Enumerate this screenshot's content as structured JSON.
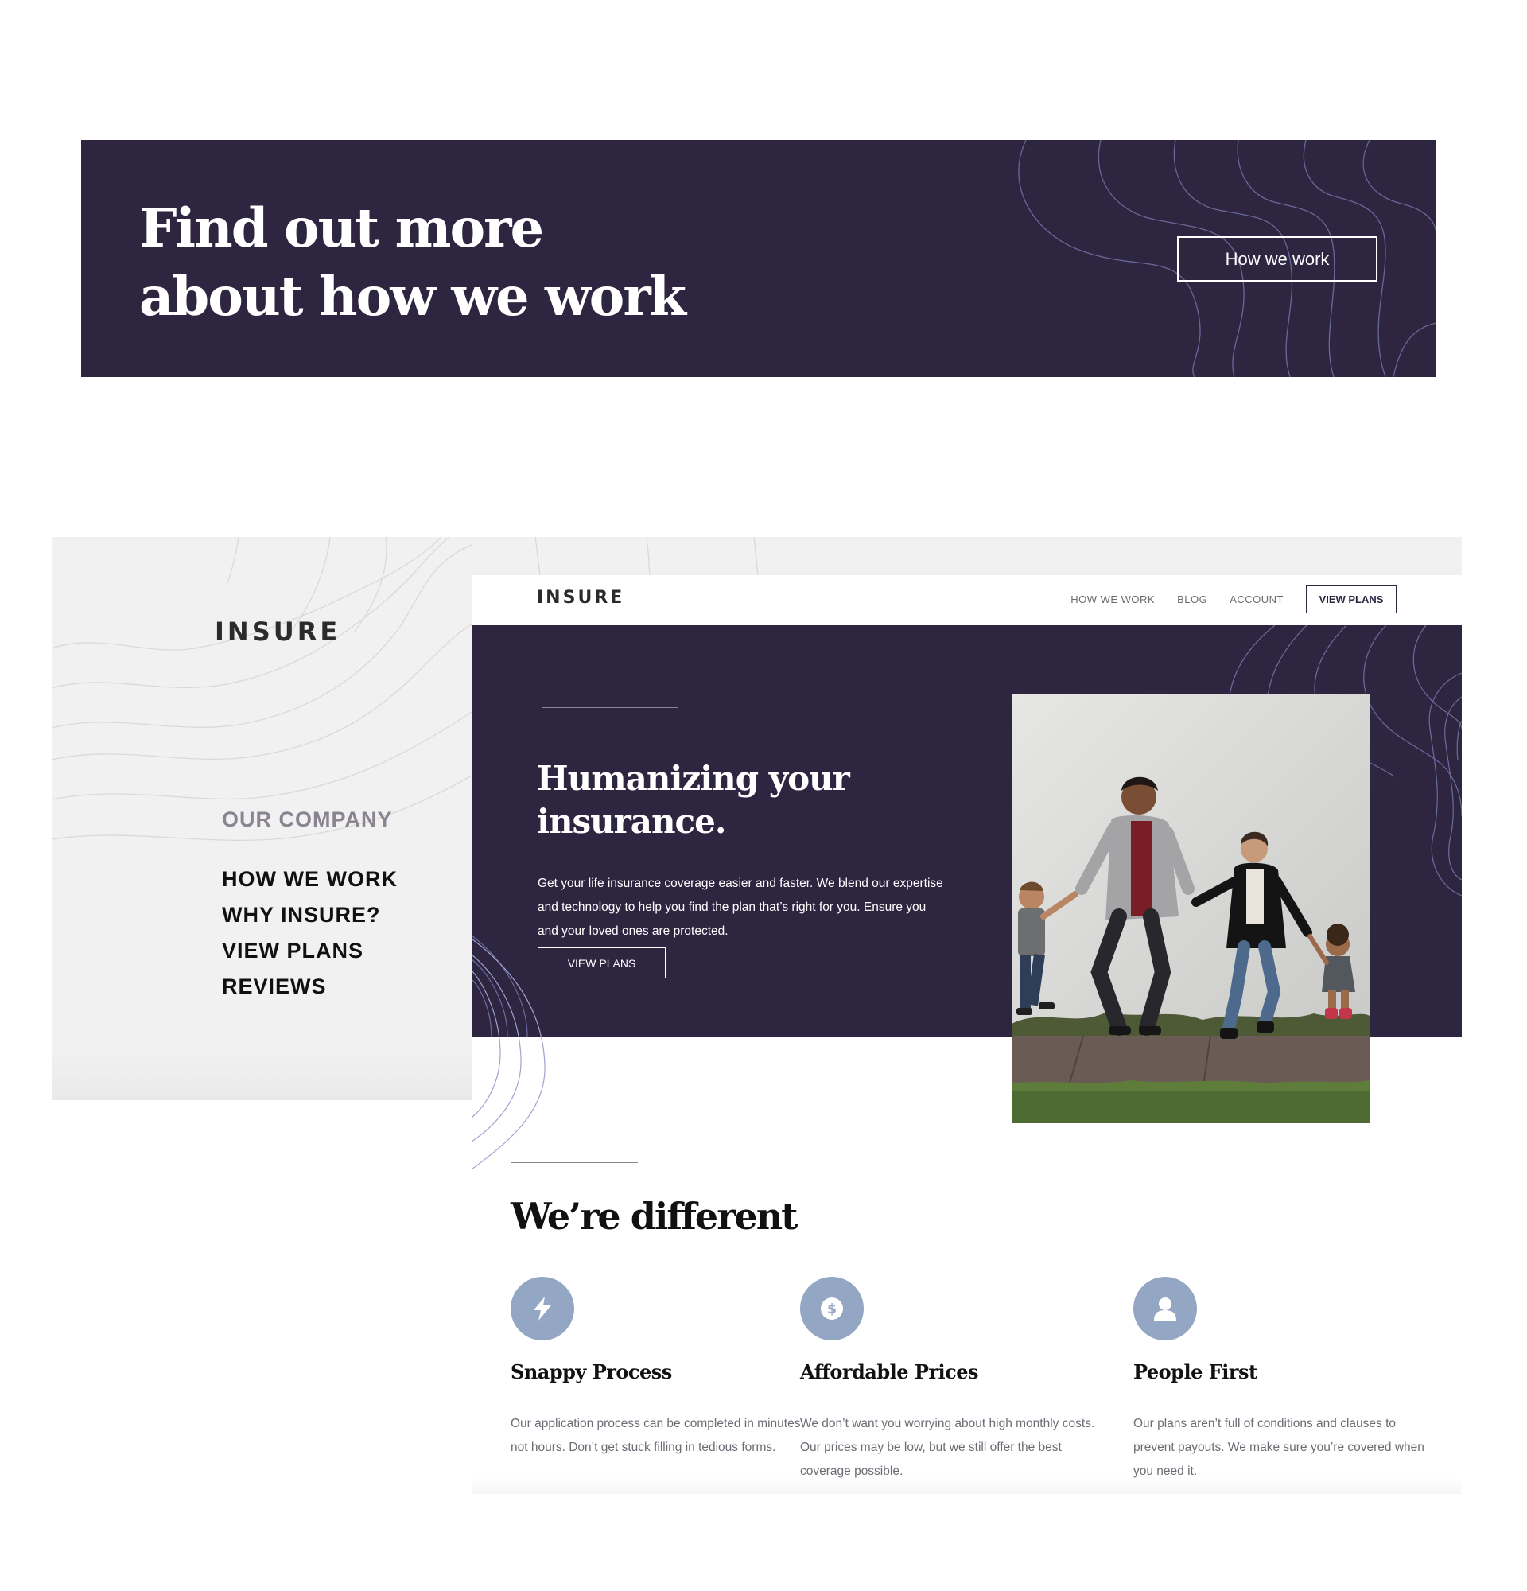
{
  "cta_banner": {
    "title": "Find out more\nabout how we work",
    "button_label": "How we work"
  },
  "mobile_menu": {
    "logo": "INSURE",
    "heading": "OUR COMPANY",
    "items": [
      "HOW WE WORK",
      "WHY INSURE?",
      "VIEW PLANS",
      "REVIEWS"
    ]
  },
  "site_header": {
    "logo": "INSURE",
    "nav": [
      "HOW WE WORK",
      "BLOG",
      "ACCOUNT"
    ],
    "cta_label": "VIEW PLANS"
  },
  "hero": {
    "title": "Humanizing your\ninsurance.",
    "text": "Get your life insurance coverage easier and faster. We blend our expertise and technology to help you find the plan that’s right for you. Ensure you and your loved ones are protected.",
    "button_label": "VIEW PLANS"
  },
  "different": {
    "title": "We’re different",
    "features": [
      {
        "icon": "lightning-icon",
        "title": "Snappy Process",
        "text": "Our application process can be completed in minutes, not hours. Don’t get stuck filling in tedious forms."
      },
      {
        "icon": "dollar-icon",
        "title": "Affordable Prices",
        "text": "We don’t want you worrying about high monthly costs. Our prices may be low, but we still offer the best coverage possible."
      },
      {
        "icon": "person-icon",
        "title": "People First",
        "text": "Our plans aren’t full of conditions and clauses to prevent payouts. We make sure you’re covered when you need it."
      }
    ]
  },
  "colors": {
    "dark_violet": "#2e2640",
    "light_grey": "#f1f1f1",
    "icon_blue": "#93a6c3",
    "contour_line": "#7a7fb8"
  }
}
